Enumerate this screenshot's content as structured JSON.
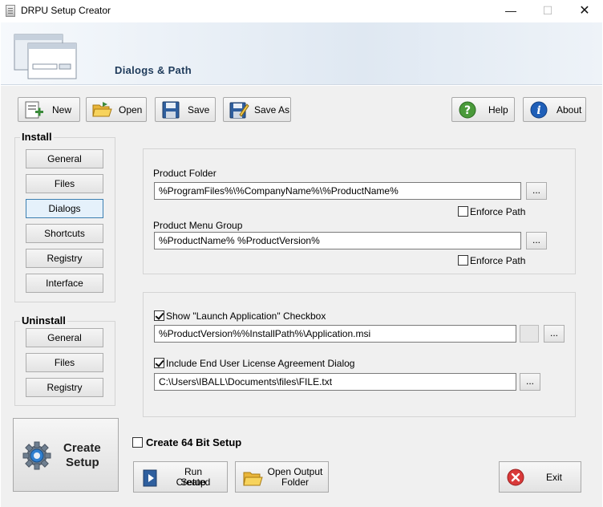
{
  "window": {
    "title": "DRPU Setup Creator",
    "controls": {
      "minimize": "—",
      "maximize": "☐",
      "close": "✕"
    }
  },
  "header": {
    "title": "Dialogs & Path"
  },
  "toolbar": {
    "new_label": "New",
    "open_label": "Open",
    "save_label": "Save",
    "save_as_label": "Save As",
    "help_label": "Help",
    "about_label": "About"
  },
  "install": {
    "title": "Install",
    "items": [
      {
        "label": "General",
        "active": false
      },
      {
        "label": "Files",
        "active": false
      },
      {
        "label": "Dialogs",
        "active": true
      },
      {
        "label": "Shortcuts",
        "active": false
      },
      {
        "label": "Registry",
        "active": false
      },
      {
        "label": "Interface",
        "active": false
      }
    ]
  },
  "uninstall": {
    "title": "Uninstall",
    "items": [
      {
        "label": "General"
      },
      {
        "label": "Files"
      },
      {
        "label": "Registry"
      }
    ]
  },
  "create_setup": {
    "line1": "Create",
    "line2": "Setup"
  },
  "paths": {
    "product_folder_label": "Product Folder",
    "product_folder_value": "%ProgramFiles%\\%CompanyName%\\%ProductName%",
    "enforce_path_label": "Enforce Path",
    "enforce_path_1_checked": false,
    "product_menu_group_label": "Product Menu Group",
    "product_menu_group_value": "%ProductName% %ProductVersion%",
    "enforce_path_2_checked": false,
    "browse_label": "..."
  },
  "launch": {
    "show_launch_label": "Show \"Launch Application\" Checkbox",
    "show_launch_checked": true,
    "launch_path_value": "%ProductVersion%%InstallPath%\\Application.msi",
    "eula_label": "Include End User License Agreement Dialog",
    "eula_checked": true,
    "eula_path_value": "C:\\Users\\IBALL\\Documents\\files\\FILE.txt"
  },
  "create_64": {
    "label": "Create 64 Bit Setup",
    "checked": false
  },
  "bottom": {
    "run_line1": "Run Created",
    "run_line2": "Setup",
    "open_line1": "Open Output",
    "open_line2": "Folder",
    "exit_label": "Exit"
  },
  "colors": {
    "accent": "#3c7fb1",
    "header_title": "#1e3a5a",
    "exit_red": "#d93a3a",
    "help_green": "#4a9a3a",
    "about_blue": "#1f5fb8"
  },
  "icons": [
    "new-file-icon",
    "open-folder-icon",
    "save-disk-icon",
    "save-as-icon",
    "help-icon",
    "about-icon",
    "gear-icon",
    "run-setup-icon",
    "folder-icon",
    "exit-icon"
  ]
}
